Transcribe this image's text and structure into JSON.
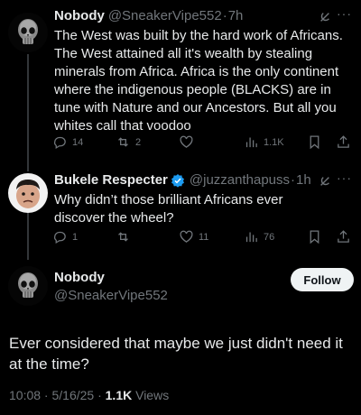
{
  "tweet1": {
    "name": "Nobody",
    "handle": "@SneakerVipe552",
    "time": "7h",
    "text": "The West was built by the hard work of Africans. The West attained all it's wealth by stealing minerals from Africa. Africa is the only continent where the indigenous people (BLACKS) are in tune with Nature and our Ancestors. But all you whites call that voodoo",
    "replies": "14",
    "reposts": "2",
    "likes": "",
    "views": "1.1K"
  },
  "tweet2": {
    "name": "Bukele Respecter",
    "handle": "@juzzanthapuss",
    "time": "1h",
    "text": "Why didn’t those brilliant Africans ever discover the wheel?",
    "replies": "1",
    "reposts": "",
    "likes": "11",
    "views": "76"
  },
  "main": {
    "name": "Nobody",
    "handle": "@SneakerVipe552",
    "follow_label": "Follow",
    "text": "Ever considered that maybe we just didn't need it at the time?",
    "date": "10:08 · 5/16/25 · ",
    "views_count": "1.1K",
    "views_label": " Views"
  },
  "icons": {
    "reply": "reply-icon",
    "repost": "repost-icon",
    "like": "heart-icon",
    "views": "views-icon",
    "bookmark": "bookmark-icon",
    "share": "share-icon",
    "grok": "grok-icon",
    "more": "more-icon",
    "verified": "verified-badge-icon"
  },
  "colors": {
    "background": "#000000",
    "text": "#e7e9ea",
    "muted": "#71767b",
    "verified": "#1d9bf0"
  }
}
